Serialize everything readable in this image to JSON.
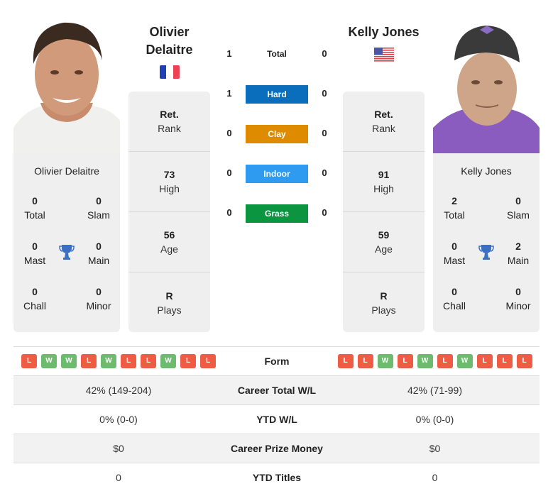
{
  "colors": {
    "hard": "#0a6ebd",
    "clay": "#df8b00",
    "indoor": "#2e9bf0",
    "grass": "#0b9540",
    "win": "#6cbb6e",
    "loss": "#ed5c43",
    "trophy": "#3b6fc4",
    "panel": "#efefef"
  },
  "player_left": {
    "name_line1": "Olivier",
    "name_line2": "Delaitre",
    "full_name": "Olivier Delaitre",
    "flag": "france-flag",
    "rank": {
      "value": "Ret.",
      "label": "Rank"
    },
    "high": {
      "value": "73",
      "label": "High"
    },
    "age": {
      "value": "56",
      "label": "Age"
    },
    "plays": {
      "value": "R",
      "label": "Plays"
    },
    "titles": {
      "total": {
        "value": "0",
        "label": "Total"
      },
      "slam": {
        "value": "0",
        "label": "Slam"
      },
      "mast": {
        "value": "0",
        "label": "Mast"
      },
      "main": {
        "value": "0",
        "label": "Main"
      },
      "chall": {
        "value": "0",
        "label": "Chall"
      },
      "minor": {
        "value": "0",
        "label": "Minor"
      }
    },
    "form": [
      "L",
      "W",
      "W",
      "L",
      "W",
      "L",
      "L",
      "W",
      "L",
      "L"
    ]
  },
  "player_right": {
    "name": "Kelly Jones",
    "full_name": "Kelly Jones",
    "flag": "usa-flag",
    "rank": {
      "value": "Ret.",
      "label": "Rank"
    },
    "high": {
      "value": "91",
      "label": "High"
    },
    "age": {
      "value": "59",
      "label": "Age"
    },
    "plays": {
      "value": "R",
      "label": "Plays"
    },
    "titles": {
      "total": {
        "value": "2",
        "label": "Total"
      },
      "slam": {
        "value": "0",
        "label": "Slam"
      },
      "mast": {
        "value": "0",
        "label": "Mast"
      },
      "main": {
        "value": "2",
        "label": "Main"
      },
      "chall": {
        "value": "0",
        "label": "Chall"
      },
      "minor": {
        "value": "0",
        "label": "Minor"
      }
    },
    "form": [
      "L",
      "L",
      "W",
      "L",
      "W",
      "L",
      "W",
      "L",
      "L",
      "L"
    ]
  },
  "h2h": [
    {
      "label": "Total",
      "left": "1",
      "right": "0",
      "surface": "total"
    },
    {
      "label": "Hard",
      "left": "1",
      "right": "0",
      "surface": "hard"
    },
    {
      "label": "Clay",
      "left": "0",
      "right": "0",
      "surface": "clay"
    },
    {
      "label": "Indoor",
      "left": "0",
      "right": "0",
      "surface": "indoor"
    },
    {
      "label": "Grass",
      "left": "0",
      "right": "0",
      "surface": "grass"
    }
  ],
  "table": {
    "form_label": "Form",
    "rows": [
      {
        "label": "Career Total W/L",
        "left": "42% (149-204)",
        "right": "42% (71-99)"
      },
      {
        "label": "YTD W/L",
        "left": "0% (0-0)",
        "right": "0% (0-0)"
      },
      {
        "label": "Career Prize Money",
        "left": "$0",
        "right": "$0"
      },
      {
        "label": "YTD Titles",
        "left": "0",
        "right": "0"
      }
    ]
  }
}
